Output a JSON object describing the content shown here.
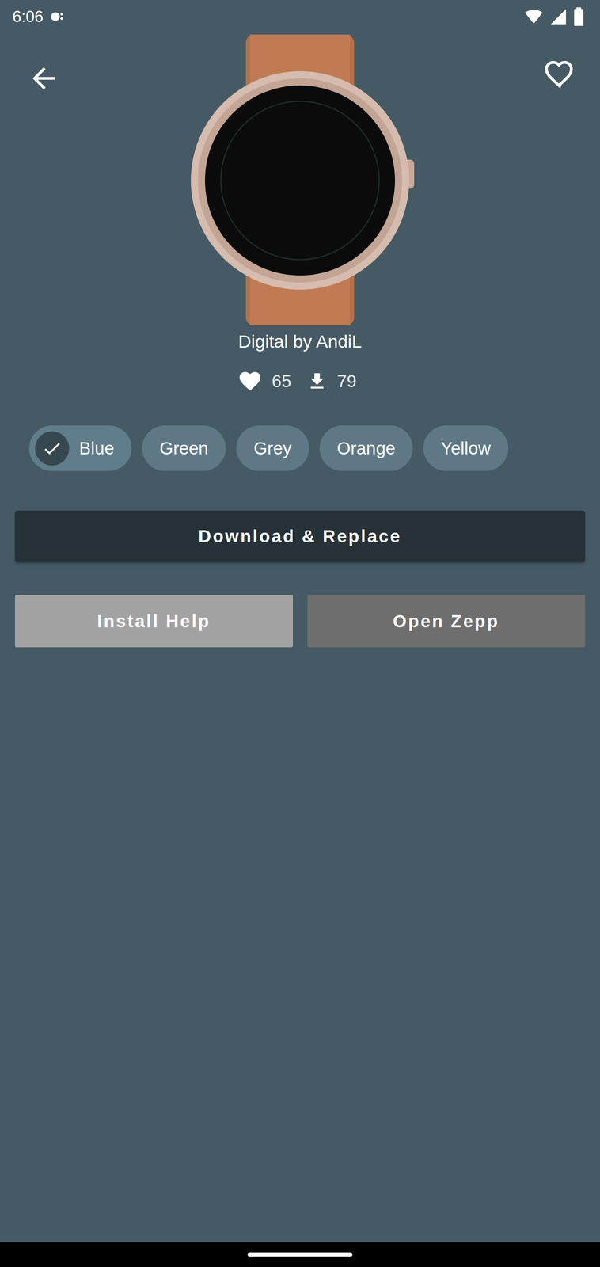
{
  "status_bar": {
    "time": "6:06"
  },
  "favorite": false,
  "watch_face": {
    "title": "Digital by AndiL",
    "likes": "65",
    "downloads": "79"
  },
  "variants": [
    {
      "label": "Blue",
      "selected": true
    },
    {
      "label": "Green",
      "selected": false
    },
    {
      "label": "Grey",
      "selected": false
    },
    {
      "label": "Orange",
      "selected": false
    },
    {
      "label": "Yellow",
      "selected": false
    }
  ],
  "buttons": {
    "primary": "Download & Replace",
    "secondary": [
      "Install Help",
      "Open Zepp"
    ]
  }
}
